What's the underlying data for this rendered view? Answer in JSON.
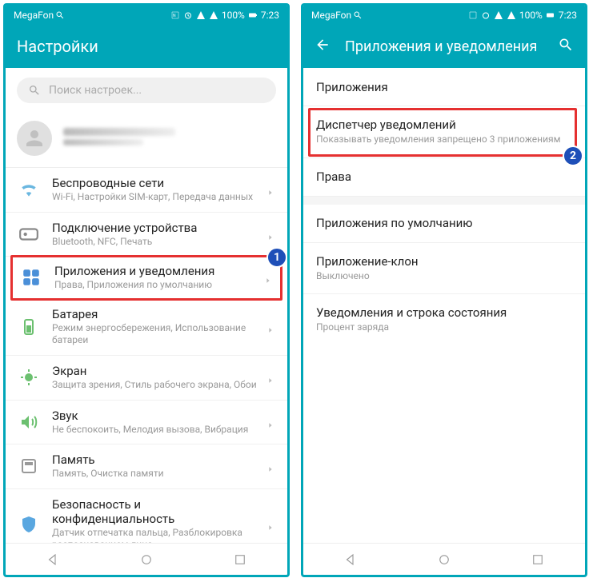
{
  "statusbar": {
    "carrier": "MegaFon",
    "battery": "100%",
    "time": "7:23"
  },
  "left": {
    "header": {
      "title": "Настройки"
    },
    "search": {
      "placeholder": "Поиск настроек..."
    },
    "items": [
      {
        "title": "Беспроводные сети",
        "sub": "Wi-Fi, Настройки SIM-карт, Передача данных"
      },
      {
        "title": "Подключение устройства",
        "sub": "Bluetooth, NFC, Печать"
      },
      {
        "title": "Приложения и уведомления",
        "sub": "Права, Приложения по умолчанию"
      },
      {
        "title": "Батарея",
        "sub": "Режим энергосбережения, Использование батареи"
      },
      {
        "title": "Экран",
        "sub": "Защита зрения, Стиль рабочего экрана, Обои"
      },
      {
        "title": "Звук",
        "sub": "Не беспокоить, Мелодия вызова, Вибрация"
      },
      {
        "title": "Память",
        "sub": "Память, Очистка памяти"
      },
      {
        "title": "Безопасность и конфиденциальность",
        "sub": "Датчик отпечатка пальца, Разблокировка распознаванием лица"
      }
    ],
    "badge": "1"
  },
  "right": {
    "header": {
      "title": "Приложения и уведомления"
    },
    "items": [
      {
        "title": "Приложения",
        "sub": ""
      },
      {
        "title": "Диспетчер уведомлений",
        "sub": "Показывать уведомления запрещено 3 приложениям"
      },
      {
        "title": "Права",
        "sub": ""
      },
      {
        "title": "Приложения по умолчанию",
        "sub": ""
      },
      {
        "title": "Приложение-клон",
        "sub": "Выключено"
      },
      {
        "title": "Уведомления и строка состояния",
        "sub": "Процент заряда"
      }
    ],
    "badge": "2"
  }
}
